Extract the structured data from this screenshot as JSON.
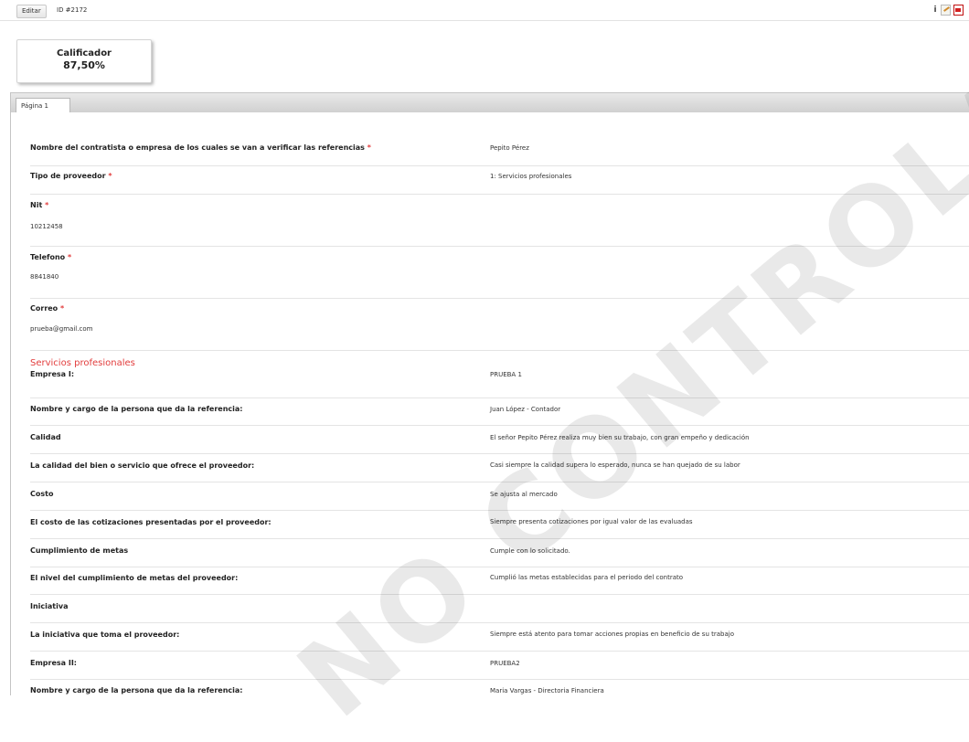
{
  "toolbar": {
    "edit_label": "Editar",
    "id_label": "ID #2172",
    "icons": [
      "info-icon",
      "edit-icon",
      "pdf-icon"
    ]
  },
  "score": {
    "title": "Calificador",
    "value": "87,50%"
  },
  "tabs": [
    {
      "label": "Página 1",
      "active": true
    }
  ],
  "fields": {
    "contractor": {
      "label": "Nombre del contratista o empresa de los cuales se van a verificar las referencias",
      "required": "*",
      "value": "Pepito Pérez"
    },
    "provider_type": {
      "label": "Tipo de proveedor",
      "required": "*",
      "value": "1: Servicios profesionales"
    },
    "nit": {
      "label": "Nit",
      "required": "*",
      "value": "10212458"
    },
    "phone": {
      "label": "Telefono",
      "required": "*",
      "value": "8841840"
    },
    "email": {
      "label": "Correo",
      "required": "*",
      "value": "prueba@gmail.com"
    }
  },
  "section_title": "Servicios profesionales",
  "items": [
    {
      "label": "Empresa I:",
      "value": "PRUEBA 1"
    },
    {
      "label": "Nombre y cargo de la persona que da la referencia:",
      "value": "Juan López - Contador"
    },
    {
      "label": "Calidad",
      "value": "El señor Pepito Pérez realiza muy bien su trabajo, con gran empeño y dedicación"
    },
    {
      "label": "La calidad del bien o servicio que ofrece el proveedor:",
      "value": "Casi siempre la calidad supera lo esperado, nunca se han quejado de su labor"
    },
    {
      "label": "Costo",
      "value": "Se ajusta al mercado"
    },
    {
      "label": "El costo de las cotizaciones presentadas por el proveedor:",
      "value": "Siempre presenta cotizaciones por igual valor de las evaluadas"
    },
    {
      "label": "Cumplimiento de metas",
      "value": "Cumple con lo solicitado."
    },
    {
      "label": "El nivel del cumplimiento de metas del proveedor:",
      "value": "Cumplió las metas establecidas para el periodo del contrato"
    },
    {
      "label": "Iniciativa",
      "value": ""
    },
    {
      "label": "La iniciativa que toma el proveedor:",
      "value": "Siempre está atento para tomar acciones propias en beneficio de su trabajo"
    },
    {
      "label": "Empresa II:",
      "value": "PRUEBA2"
    },
    {
      "label": "Nombre y cargo de la persona que da la referencia:",
      "value": "Maria Vargas - Directoria Financiera"
    }
  ],
  "watermark": "NO CONTROLADA"
}
